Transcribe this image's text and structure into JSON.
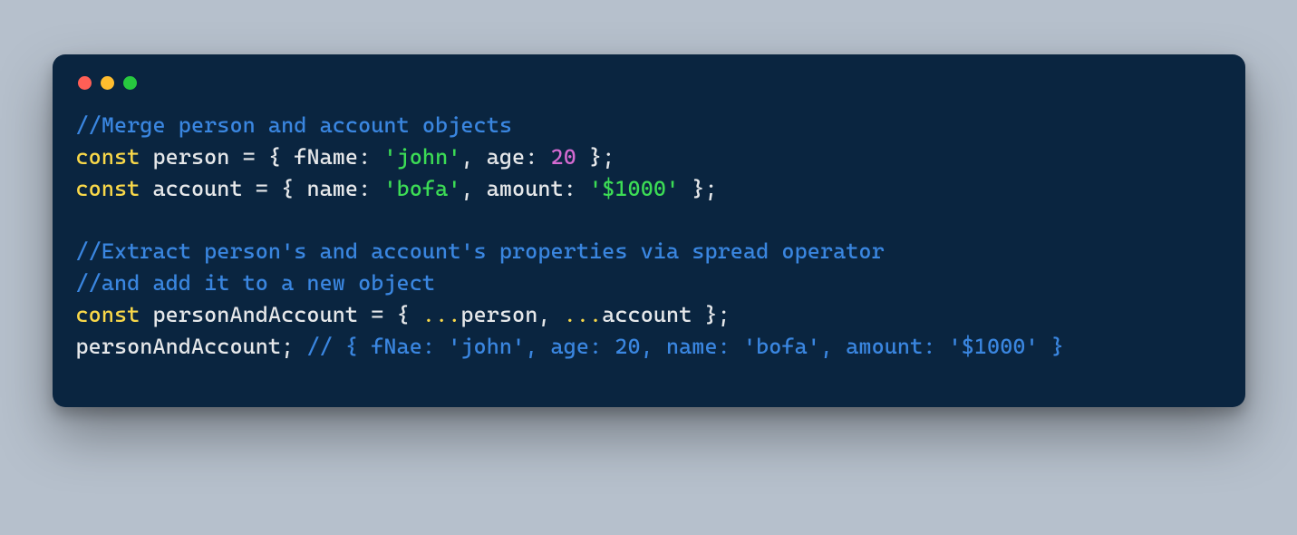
{
  "window": {
    "traffic_light_colors": {
      "close": "#ff5f56",
      "minimize": "#ffbd2e",
      "zoom": "#27c93f"
    }
  },
  "code": {
    "lines": [
      [
        {
          "cls": "tk-comment",
          "text": "//Merge person and account objects"
        }
      ],
      [
        {
          "cls": "tk-keyword",
          "text": "const"
        },
        {
          "cls": "tk-punct",
          "text": " "
        },
        {
          "cls": "tk-ident",
          "text": "person"
        },
        {
          "cls": "tk-punct",
          "text": " = { "
        },
        {
          "cls": "tk-prop",
          "text": "fName"
        },
        {
          "cls": "tk-punct",
          "text": ": "
        },
        {
          "cls": "tk-string",
          "text": "'john'"
        },
        {
          "cls": "tk-punct",
          "text": ", "
        },
        {
          "cls": "tk-prop",
          "text": "age"
        },
        {
          "cls": "tk-punct",
          "text": ": "
        },
        {
          "cls": "tk-number",
          "text": "20"
        },
        {
          "cls": "tk-punct",
          "text": " };"
        }
      ],
      [
        {
          "cls": "tk-keyword",
          "text": "const"
        },
        {
          "cls": "tk-punct",
          "text": " "
        },
        {
          "cls": "tk-ident",
          "text": "account"
        },
        {
          "cls": "tk-punct",
          "text": " = { "
        },
        {
          "cls": "tk-prop",
          "text": "name"
        },
        {
          "cls": "tk-punct",
          "text": ": "
        },
        {
          "cls": "tk-string",
          "text": "'bofa'"
        },
        {
          "cls": "tk-punct",
          "text": ", "
        },
        {
          "cls": "tk-prop",
          "text": "amount"
        },
        {
          "cls": "tk-punct",
          "text": ": "
        },
        {
          "cls": "tk-string",
          "text": "'$1000'"
        },
        {
          "cls": "tk-punct",
          "text": " };"
        }
      ],
      [],
      [
        {
          "cls": "tk-comment",
          "text": "//Extract person's and account's properties via spread operator"
        }
      ],
      [
        {
          "cls": "tk-comment",
          "text": "//and add it to a new object"
        }
      ],
      [
        {
          "cls": "tk-keyword",
          "text": "const"
        },
        {
          "cls": "tk-punct",
          "text": " "
        },
        {
          "cls": "tk-ident",
          "text": "personAndAccount"
        },
        {
          "cls": "tk-punct",
          "text": " = { "
        },
        {
          "cls": "tk-spread",
          "text": "..."
        },
        {
          "cls": "tk-ident",
          "text": "person"
        },
        {
          "cls": "tk-punct",
          "text": ", "
        },
        {
          "cls": "tk-spread",
          "text": "..."
        },
        {
          "cls": "tk-ident",
          "text": "account"
        },
        {
          "cls": "tk-punct",
          "text": " };"
        }
      ],
      [
        {
          "cls": "tk-ident",
          "text": "personAndAccount"
        },
        {
          "cls": "tk-punct",
          "text": "; "
        },
        {
          "cls": "tk-comment",
          "text": "// { fNae: 'john', age: 20, name: 'bofa', amount: '$1000' }"
        }
      ]
    ]
  }
}
